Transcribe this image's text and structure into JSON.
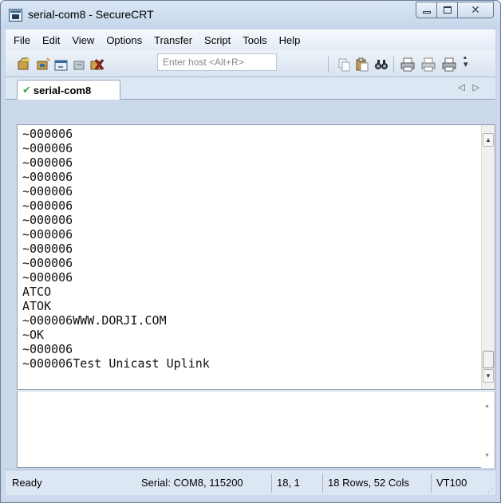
{
  "window": {
    "title": "serial-com8 - SecureCRT"
  },
  "menu": [
    "File",
    "Edit",
    "View",
    "Options",
    "Transfer",
    "Script",
    "Tools",
    "Help"
  ],
  "toolbar": {
    "host_placeholder": "Enter host <Alt+R>"
  },
  "tabs": [
    {
      "label": "serial-com8",
      "status": "connected"
    }
  ],
  "terminal": {
    "lines": [
      "~000006",
      "~000006",
      "~000006",
      "~000006",
      "~000006",
      "~000006",
      "~000006",
      "~000006",
      "~000006",
      "~000006",
      "~000006",
      "ATCO",
      "ATOK",
      "~000006WWW.DORJI.COM",
      "~OK",
      "~000006",
      "~000006Test Unicast Uplink"
    ]
  },
  "status": {
    "state": "Ready",
    "connection": "Serial: COM8, 115200",
    "cursor": "18,  1",
    "dimensions": "18 Rows, 52 Cols",
    "emulation": "VT100"
  },
  "colors": {
    "title_bar": "#c4d5ea",
    "connected_icon": "#3aa648",
    "window_border": "#6d7f98"
  }
}
